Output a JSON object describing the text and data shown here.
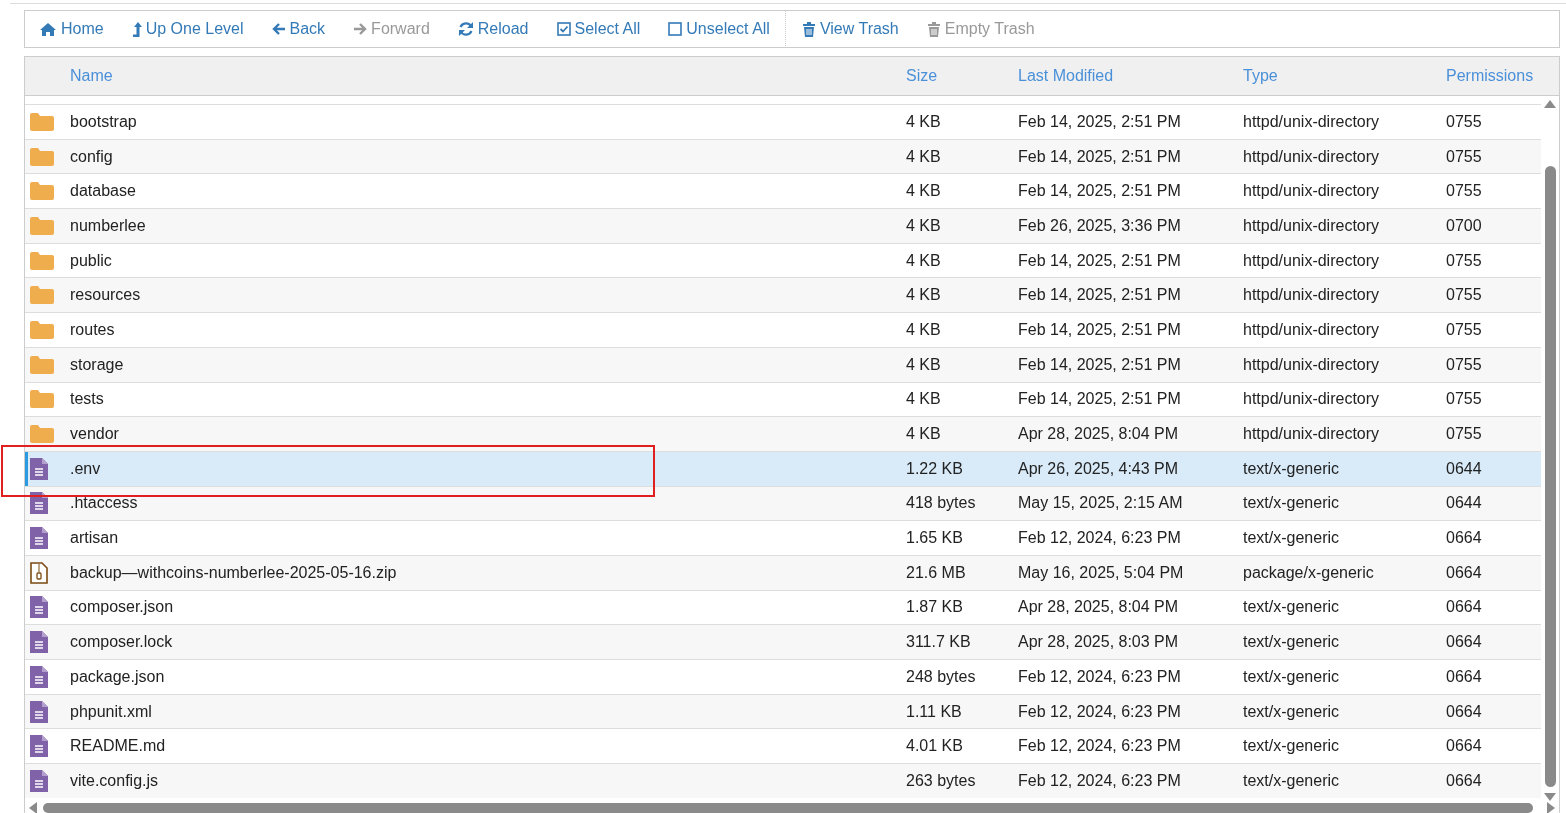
{
  "toolbar": [
    {
      "kind": "home",
      "label": "Home",
      "disabled": false
    },
    {
      "kind": "up",
      "label": "Up One Level",
      "disabled": false
    },
    {
      "kind": "back",
      "label": "Back",
      "disabled": false
    },
    {
      "kind": "forward",
      "label": "Forward",
      "disabled": true
    },
    {
      "kind": "reload",
      "label": "Reload",
      "disabled": false
    },
    {
      "kind": "select",
      "label": "Select All",
      "disabled": false
    },
    {
      "kind": "unselect",
      "label": "Unselect All",
      "disabled": false
    },
    {
      "kind": "trash",
      "label": "View Trash",
      "disabled": false
    },
    {
      "kind": "trash",
      "label": "Empty Trash",
      "disabled": true
    }
  ],
  "table": {
    "columns": [
      "Name",
      "Size",
      "Last Modified",
      "Type",
      "Permissions"
    ],
    "rows": [
      {
        "kind": "folder",
        "name": "bootstrap",
        "size": "4 KB",
        "modified": "Feb 14, 2025, 2:51 PM",
        "type": "httpd/unix-directory",
        "permissions": "0755",
        "selected": false
      },
      {
        "kind": "folder",
        "name": "config",
        "size": "4 KB",
        "modified": "Feb 14, 2025, 2:51 PM",
        "type": "httpd/unix-directory",
        "permissions": "0755",
        "selected": false
      },
      {
        "kind": "folder",
        "name": "database",
        "size": "4 KB",
        "modified": "Feb 14, 2025, 2:51 PM",
        "type": "httpd/unix-directory",
        "permissions": "0755",
        "selected": false
      },
      {
        "kind": "folder",
        "name": "numberlee",
        "size": "4 KB",
        "modified": "Feb 26, 2025, 3:36 PM",
        "type": "httpd/unix-directory",
        "permissions": "0700",
        "selected": false
      },
      {
        "kind": "folder",
        "name": "public",
        "size": "4 KB",
        "modified": "Feb 14, 2025, 2:51 PM",
        "type": "httpd/unix-directory",
        "permissions": "0755",
        "selected": false
      },
      {
        "kind": "folder",
        "name": "resources",
        "size": "4 KB",
        "modified": "Feb 14, 2025, 2:51 PM",
        "type": "httpd/unix-directory",
        "permissions": "0755",
        "selected": false
      },
      {
        "kind": "folder",
        "name": "routes",
        "size": "4 KB",
        "modified": "Feb 14, 2025, 2:51 PM",
        "type": "httpd/unix-directory",
        "permissions": "0755",
        "selected": false
      },
      {
        "kind": "folder",
        "name": "storage",
        "size": "4 KB",
        "modified": "Feb 14, 2025, 2:51 PM",
        "type": "httpd/unix-directory",
        "permissions": "0755",
        "selected": false
      },
      {
        "kind": "folder",
        "name": "tests",
        "size": "4 KB",
        "modified": "Feb 14, 2025, 2:51 PM",
        "type": "httpd/unix-directory",
        "permissions": "0755",
        "selected": false
      },
      {
        "kind": "folder",
        "name": "vendor",
        "size": "4 KB",
        "modified": "Apr 28, 2025, 8:04 PM",
        "type": "httpd/unix-directory",
        "permissions": "0755",
        "selected": false
      },
      {
        "kind": "file",
        "name": ".env",
        "size": "1.22 KB",
        "modified": "Apr 26, 2025, 4:43 PM",
        "type": "text/x-generic",
        "permissions": "0644",
        "selected": true
      },
      {
        "kind": "file",
        "name": ".htaccess",
        "size": "418 bytes",
        "modified": "May 15, 2025, 2:15 AM",
        "type": "text/x-generic",
        "permissions": "0644",
        "selected": false
      },
      {
        "kind": "file",
        "name": "artisan",
        "size": "1.65 KB",
        "modified": "Feb 12, 2024, 6:23 PM",
        "type": "text/x-generic",
        "permissions": "0664",
        "selected": false
      },
      {
        "kind": "zip",
        "name": "backup—withcoins-numberlee-2025-05-16.zip",
        "size": "21.6 MB",
        "modified": "May 16, 2025, 5:04 PM",
        "type": "package/x-generic",
        "permissions": "0664",
        "selected": false
      },
      {
        "kind": "file",
        "name": "composer.json",
        "size": "1.87 KB",
        "modified": "Apr 28, 2025, 8:04 PM",
        "type": "text/x-generic",
        "permissions": "0664",
        "selected": false
      },
      {
        "kind": "file",
        "name": "composer.lock",
        "size": "311.7 KB",
        "modified": "Apr 28, 2025, 8:03 PM",
        "type": "text/x-generic",
        "permissions": "0664",
        "selected": false
      },
      {
        "kind": "file",
        "name": "package.json",
        "size": "248 bytes",
        "modified": "Feb 12, 2024, 6:23 PM",
        "type": "text/x-generic",
        "permissions": "0664",
        "selected": false
      },
      {
        "kind": "file",
        "name": "phpunit.xml",
        "size": "1.11 KB",
        "modified": "Feb 12, 2024, 6:23 PM",
        "type": "text/x-generic",
        "permissions": "0664",
        "selected": false
      },
      {
        "kind": "file",
        "name": "README.md",
        "size": "4.01 KB",
        "modified": "Feb 12, 2024, 6:23 PM",
        "type": "text/x-generic",
        "permissions": "0664",
        "selected": false
      },
      {
        "kind": "file",
        "name": "vite.config.js",
        "size": "263 bytes",
        "modified": "Feb 12, 2024, 6:23 PM",
        "type": "text/x-generic",
        "permissions": "0664",
        "selected": false
      }
    ]
  }
}
